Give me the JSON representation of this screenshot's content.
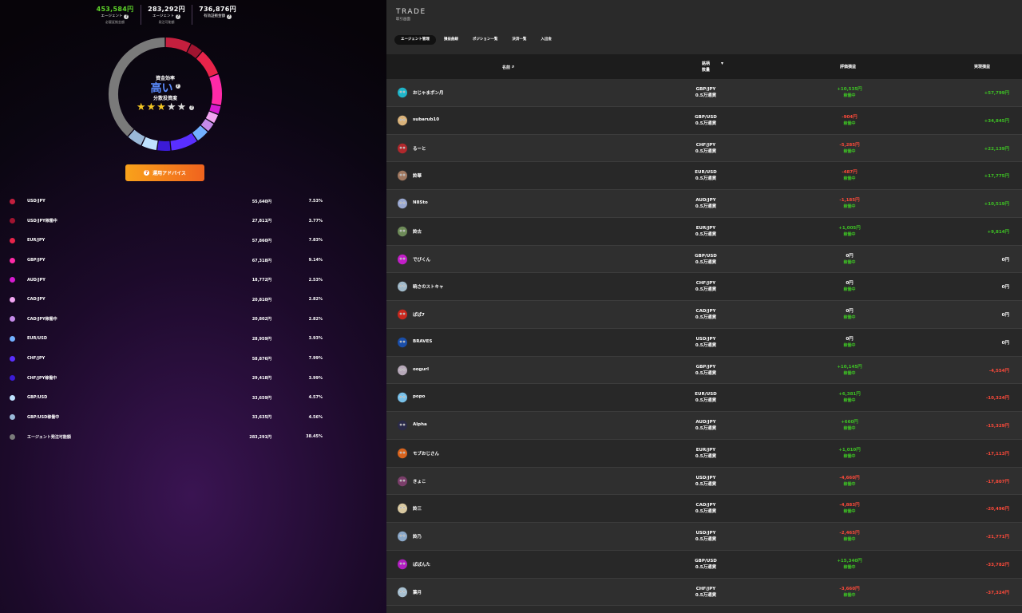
{
  "stats": [
    {
      "value": "453,584円",
      "label": "エージェント",
      "sub": "必要証拠金額",
      "color": "#5fd62a"
    },
    {
      "value": "283,292円",
      "label": "エージェント",
      "sub": "発注可能額",
      "color": "#ffffff"
    },
    {
      "value": "736,876円",
      "label": "",
      "sub": "有効証拠金額",
      "color": "#ffffff"
    }
  ],
  "donut": {
    "label": "資金効率",
    "level": "高い",
    "sub": "分散投資度",
    "stars_on": 3,
    "stars_total": 5,
    "segments": [
      {
        "pct": 7.53,
        "color": "#c41f3e"
      },
      {
        "pct": 3.77,
        "color": "#a01430"
      },
      {
        "pct": 7.83,
        "color": "#e8244a"
      },
      {
        "pct": 9.14,
        "color": "#ff2aa8"
      },
      {
        "pct": 2.53,
        "color": "#d61ad0"
      },
      {
        "pct": 2.82,
        "color": "#f2a5f2"
      },
      {
        "pct": 2.82,
        "color": "#c48ae8"
      },
      {
        "pct": 3.93,
        "color": "#72b0ff"
      },
      {
        "pct": 7.99,
        "color": "#5a2fff"
      },
      {
        "pct": 3.99,
        "color": "#3b1bd6"
      },
      {
        "pct": 4.57,
        "color": "#bfe2ff"
      },
      {
        "pct": 4.56,
        "color": "#9ab8d8"
      },
      {
        "pct": 38.45,
        "color": "#7a7a7a"
      }
    ]
  },
  "advice_label": "運用アドバイス",
  "allocation": [
    {
      "name": "USD/JPY",
      "amount": "55,640円",
      "pct": "7.53%",
      "color": "#c41f3e"
    },
    {
      "name": "USD/JPY稼働中",
      "amount": "27,811円",
      "pct": "3.77%",
      "color": "#a01430"
    },
    {
      "name": "EUR/JPY",
      "amount": "57,860円",
      "pct": "7.83%",
      "color": "#e8244a"
    },
    {
      "name": "GBP/JPY",
      "amount": "67,318円",
      "pct": "9.14%",
      "color": "#ff2aa8"
    },
    {
      "name": "AUD/JPY",
      "amount": "18,772円",
      "pct": "2.53%",
      "color": "#d61ad0"
    },
    {
      "name": "CAD/JPY",
      "amount": "20,810円",
      "pct": "2.82%",
      "color": "#f2a5f2"
    },
    {
      "name": "CAD/JPY稼働中",
      "amount": "20,802円",
      "pct": "2.82%",
      "color": "#c48ae8"
    },
    {
      "name": "EUR/USD",
      "amount": "28,959円",
      "pct": "3.93%",
      "color": "#72b0ff"
    },
    {
      "name": "CHF/JPY",
      "amount": "58,876円",
      "pct": "7.99%",
      "color": "#5a2fff"
    },
    {
      "name": "CHF/JPY稼働中",
      "amount": "29,418円",
      "pct": "3.99%",
      "color": "#3b1bd6"
    },
    {
      "name": "GBP/USD",
      "amount": "33,659円",
      "pct": "4.57%",
      "color": "#bfe2ff"
    },
    {
      "name": "GBP/USD稼働中",
      "amount": "33,635円",
      "pct": "4.56%",
      "color": "#9ab8d8"
    },
    {
      "name": "エージェント発注可能額",
      "amount": "283,291円",
      "pct": "38.45%",
      "color": "#7a7a7a"
    }
  ],
  "right": {
    "title": "TRADE",
    "subtitle": "取引画面",
    "tabs": [
      "エージェント管理",
      "損益曲線",
      "ポジション一覧",
      "決済一覧",
      "入出金"
    ],
    "header": {
      "name": "名前",
      "pair1": "銘柄",
      "pair2": "数量",
      "eval": "評価損益",
      "real": "実現損益"
    }
  },
  "agents": [
    {
      "name": "おじゃまポン月",
      "pair": "GBP/JPY",
      "qty": "0.5万通貨",
      "eval": "+10,535円",
      "evalSign": "pos",
      "real": "+57,799円",
      "realSign": "pos",
      "avatar": "#1fb4c8"
    },
    {
      "name": "subarub10",
      "pair": "GBP/USD",
      "qty": "0.5万通貨",
      "eval": "-904円",
      "evalSign": "neg",
      "real": "+34,845円",
      "realSign": "pos",
      "avatar": "#d9b27a"
    },
    {
      "name": "るーと",
      "pair": "CHF/JPY",
      "qty": "0.5万通貨",
      "eval": "-5,285円",
      "evalSign": "neg",
      "real": "+22,139円",
      "realSign": "pos",
      "avatar": "#b0282c"
    },
    {
      "name": "鈴華",
      "pair": "EUR/USD",
      "qty": "0.5万通貨",
      "eval": "-487円",
      "evalSign": "neg",
      "real": "+17,775円",
      "realSign": "pos",
      "avatar": "#a07860"
    },
    {
      "name": "N8Sto",
      "pair": "AUD/JPY",
      "qty": "0.5万通貨",
      "eval": "-1,185円",
      "evalSign": "neg",
      "real": "+10,519円",
      "realSign": "pos",
      "avatar": "#9aa8d0"
    },
    {
      "name": "鈴古",
      "pair": "EUR/JPY",
      "qty": "0.5万通貨",
      "eval": "+1,005円",
      "evalSign": "pos",
      "real": "+9,814円",
      "realSign": "pos",
      "avatar": "#6d8a58"
    },
    {
      "name": "でびくん",
      "pair": "GBP/USD",
      "qty": "0.5万通貨",
      "eval": "0円",
      "evalSign": "zero",
      "real": "0円",
      "realSign": "zero",
      "avatar": "#c21ec8"
    },
    {
      "name": "暁さのストキャ",
      "pair": "CHF/JPY",
      "qty": "0.5万通貨",
      "eval": "0円",
      "evalSign": "zero",
      "real": "0円",
      "realSign": "zero",
      "avatar": "#9fb8c8"
    },
    {
      "name": "ぱぱ7",
      "pair": "CAD/JPY",
      "qty": "0.5万通貨",
      "eval": "0円",
      "evalSign": "zero",
      "real": "0円",
      "realSign": "zero",
      "avatar": "#c8281e"
    },
    {
      "name": "BRAVES",
      "pair": "USD/JPY",
      "qty": "0.5万通貨",
      "eval": "0円",
      "evalSign": "zero",
      "real": "0円",
      "realSign": "zero",
      "avatar": "#1a4ea8"
    },
    {
      "name": "oogurl",
      "pair": "GBP/JPY",
      "qty": "0.5万通貨",
      "eval": "+10,145円",
      "evalSign": "pos",
      "real": "-4,554円",
      "realSign": "neg",
      "avatar": "#b6a8b8"
    },
    {
      "name": "popo",
      "pair": "EUR/USD",
      "qty": "0.5万通貨",
      "eval": "+6,381円",
      "evalSign": "pos",
      "real": "-10,324円",
      "realSign": "neg",
      "avatar": "#78c0e8"
    },
    {
      "name": "Alpha",
      "pair": "AUD/JPY",
      "qty": "0.5万通貨",
      "eval": "+660円",
      "evalSign": "pos",
      "real": "-15,329円",
      "realSign": "neg",
      "avatar": "#2a2a48"
    },
    {
      "name": "モブおじさん",
      "pair": "EUR/JPY",
      "qty": "0.5万通貨",
      "eval": "+1,010円",
      "evalSign": "pos",
      "real": "-17,113円",
      "realSign": "neg",
      "avatar": "#d8641e"
    },
    {
      "name": "きょこ",
      "pair": "USD/JPY",
      "qty": "0.5万通貨",
      "eval": "-4,660円",
      "evalSign": "neg",
      "real": "-17,807円",
      "realSign": "neg",
      "avatar": "#7a3e6a"
    },
    {
      "name": "鈴三",
      "pair": "CAD/JPY",
      "qty": "0.5万通貨",
      "eval": "-4,883円",
      "evalSign": "neg",
      "real": "-20,496円",
      "realSign": "neg",
      "avatar": "#d8c8a0"
    },
    {
      "name": "鈴乃",
      "pair": "USD/JPY",
      "qty": "0.5万通貨",
      "eval": "-2,465円",
      "evalSign": "neg",
      "real": "-21,771円",
      "realSign": "neg",
      "avatar": "#8aa8c8"
    },
    {
      "name": "ぱぱんた",
      "pair": "GBP/USD",
      "qty": "0.5万通貨",
      "eval": "+15,340円",
      "evalSign": "pos",
      "real": "-33,782円",
      "realSign": "neg",
      "avatar": "#b01ec0"
    },
    {
      "name": "葉月",
      "pair": "CHF/JPY",
      "qty": "0.5万通貨",
      "eval": "-3,660円",
      "evalSign": "neg",
      "real": "-37,324円",
      "realSign": "neg",
      "avatar": "#a8c0d0"
    }
  ],
  "status_label": "稼働中"
}
